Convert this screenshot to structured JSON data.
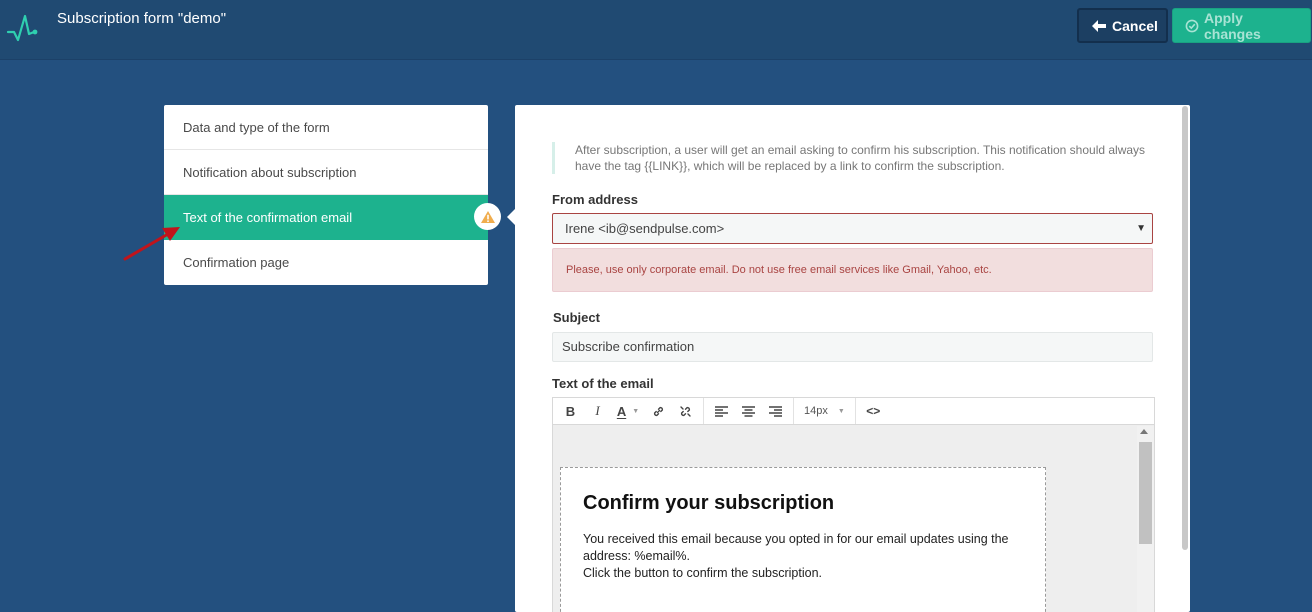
{
  "header": {
    "title": "Subscription form \"demo\"",
    "cancel_label": "Cancel",
    "apply_label": "Apply changes",
    "colors": {
      "bar": "#204a72",
      "accent": "#1db28e"
    }
  },
  "steps": [
    {
      "label": "Data and type of the form",
      "active": false
    },
    {
      "label": "Notification about subscription",
      "active": false
    },
    {
      "label": "Text of the confirmation email",
      "active": true
    },
    {
      "label": "Confirmation page",
      "active": false
    }
  ],
  "main": {
    "info_text": "After subscription, a user will get an email asking to confirm his subscription. This notification should always have the tag {{LINK}}, which will be replaced by a link to confirm the subscription.",
    "from_label": "From address",
    "from_value": "Irene <ib@sendpulse.com>",
    "from_error": "Please, use only corporate email. Do not use free email services like Gmail, Yahoo, etc.",
    "subject_label": "Subject",
    "subject_value": "Subscribe confirmation",
    "text_label": "Text of the email",
    "toolbar": {
      "buttons": [
        "bold-icon",
        "italic-icon",
        "text-color-icon",
        "link-icon",
        "unlink-icon",
        "align-left-icon",
        "align-center-icon",
        "align-right-icon",
        "code-view-icon"
      ],
      "font_size": "14px"
    },
    "email": {
      "title": "Confirm your subscription",
      "line1": "You received this email because you opted in for our email updates using the address: %email%.",
      "line2": "Click the button to confirm the subscription."
    }
  }
}
